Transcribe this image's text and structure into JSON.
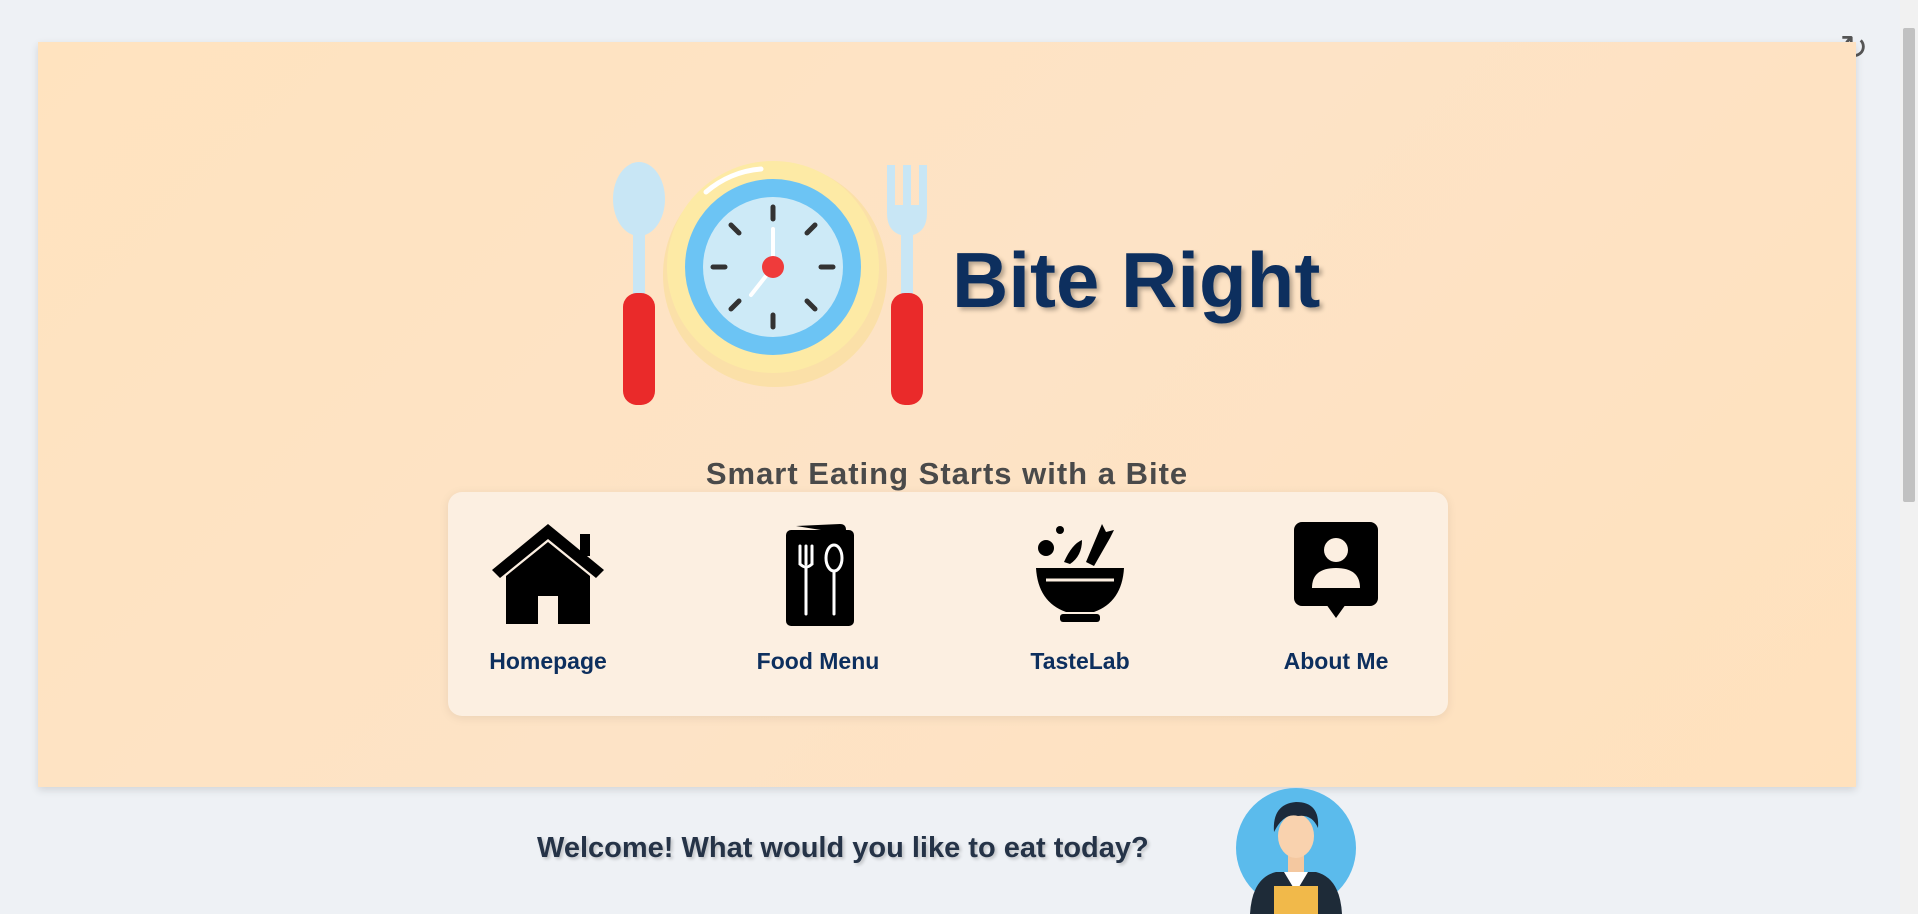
{
  "app": {
    "title": "Bite Right",
    "tagline": "Smart Eating Starts with a Bite",
    "reload_symbol": "↻"
  },
  "nav": {
    "items": [
      {
        "label": "Homepage",
        "icon": "house-icon"
      },
      {
        "label": "Food Menu",
        "icon": "menu-card-icon"
      },
      {
        "label": "TasteLab",
        "icon": "salad-bowl-icon"
      },
      {
        "label": "About Me",
        "icon": "profile-card-icon"
      }
    ]
  },
  "welcome": {
    "message": "Welcome! What would you like to eat today?"
  },
  "colors": {
    "hero_background": "#ffe3bf",
    "brand_navy": "#0d2f5e",
    "nav_card": "#fcefe1",
    "page_background": "#eef1f5"
  }
}
